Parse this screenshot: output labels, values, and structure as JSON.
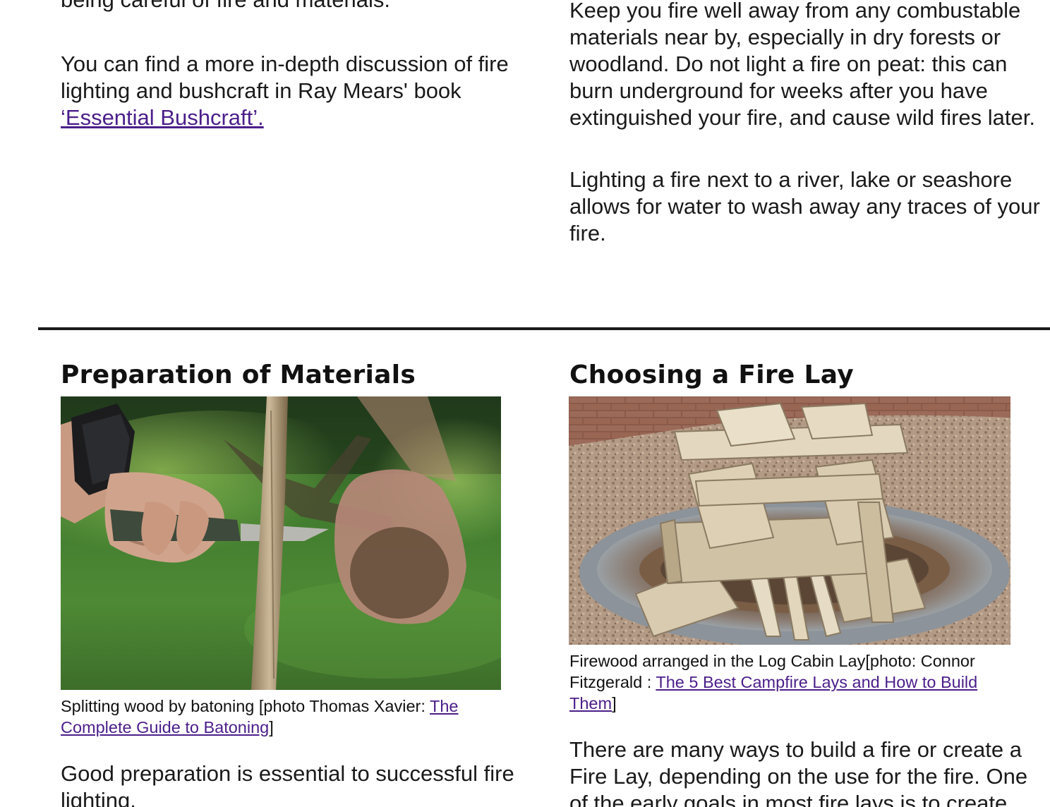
{
  "top": {
    "cut_line": "being careful of fire and materials.",
    "left_paragraph": "You can find a more in-depth discussion of fire lighting and bushcraft in Ray Mears' book ",
    "left_link": "‘Essential Bushcraft’.",
    "right_paragraph_1": "Keep you fire well away from any combustable materials near by, especially in dry forests or woodland. Do not light a fire on peat: this can burn underground for weeks after you have extinguished your fire, and cause wild fires later.",
    "right_paragraph_2": "Lighting a fire next to a river, lake or seashore allows for water to wash away any traces of your fire."
  },
  "left_section": {
    "heading": "Preparation of Materials",
    "caption_text": "Splitting wood by batoning [photo Thomas Xavier: ",
    "caption_link": "The Complete Guide to Batoning",
    "caption_end": "]",
    "body": "Good preparation is essential to successful fire lighting."
  },
  "right_section": {
    "heading": "Choosing a Fire Lay",
    "caption_text": "Firewood arranged in the Log Cabin Lay[photo: Connor Fitzgerald : ",
    "caption_link": "The 5 Best Campfire Lays and How to Build Them",
    "caption_end": "]",
    "body": "There are many ways to build a fire or create a Fire Lay, depending on the use for the fire. One of the early goals in most fire lays is to create"
  },
  "colors": {
    "link": "#4b1e8a",
    "text": "#1a1a1a",
    "rule": "#1a1a1a"
  }
}
